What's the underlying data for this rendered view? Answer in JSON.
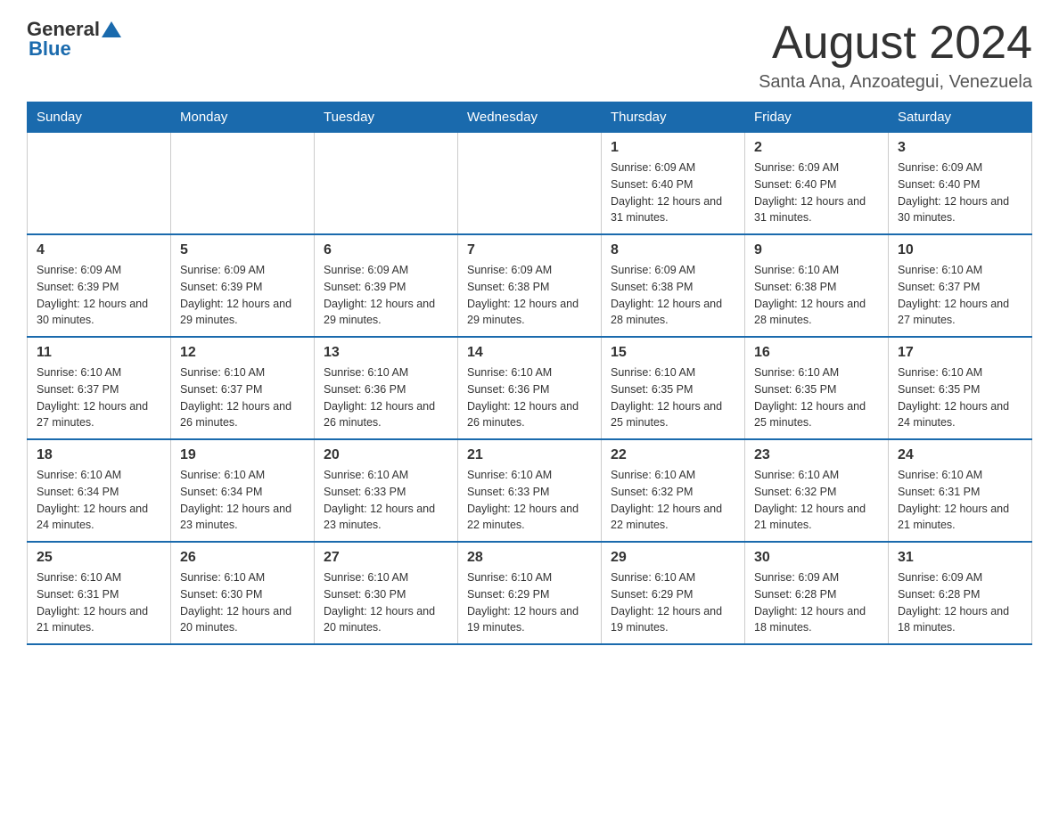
{
  "logo": {
    "text_general": "General",
    "text_blue": "Blue"
  },
  "header": {
    "month_title": "August 2024",
    "location": "Santa Ana, Anzoategui, Venezuela"
  },
  "weekdays": [
    "Sunday",
    "Monday",
    "Tuesday",
    "Wednesday",
    "Thursday",
    "Friday",
    "Saturday"
  ],
  "weeks": [
    {
      "days": [
        {
          "number": "",
          "info": ""
        },
        {
          "number": "",
          "info": ""
        },
        {
          "number": "",
          "info": ""
        },
        {
          "number": "",
          "info": ""
        },
        {
          "number": "1",
          "info": "Sunrise: 6:09 AM\nSunset: 6:40 PM\nDaylight: 12 hours and 31 minutes."
        },
        {
          "number": "2",
          "info": "Sunrise: 6:09 AM\nSunset: 6:40 PM\nDaylight: 12 hours and 31 minutes."
        },
        {
          "number": "3",
          "info": "Sunrise: 6:09 AM\nSunset: 6:40 PM\nDaylight: 12 hours and 30 minutes."
        }
      ]
    },
    {
      "days": [
        {
          "number": "4",
          "info": "Sunrise: 6:09 AM\nSunset: 6:39 PM\nDaylight: 12 hours and 30 minutes."
        },
        {
          "number": "5",
          "info": "Sunrise: 6:09 AM\nSunset: 6:39 PM\nDaylight: 12 hours and 29 minutes."
        },
        {
          "number": "6",
          "info": "Sunrise: 6:09 AM\nSunset: 6:39 PM\nDaylight: 12 hours and 29 minutes."
        },
        {
          "number": "7",
          "info": "Sunrise: 6:09 AM\nSunset: 6:38 PM\nDaylight: 12 hours and 29 minutes."
        },
        {
          "number": "8",
          "info": "Sunrise: 6:09 AM\nSunset: 6:38 PM\nDaylight: 12 hours and 28 minutes."
        },
        {
          "number": "9",
          "info": "Sunrise: 6:10 AM\nSunset: 6:38 PM\nDaylight: 12 hours and 28 minutes."
        },
        {
          "number": "10",
          "info": "Sunrise: 6:10 AM\nSunset: 6:37 PM\nDaylight: 12 hours and 27 minutes."
        }
      ]
    },
    {
      "days": [
        {
          "number": "11",
          "info": "Sunrise: 6:10 AM\nSunset: 6:37 PM\nDaylight: 12 hours and 27 minutes."
        },
        {
          "number": "12",
          "info": "Sunrise: 6:10 AM\nSunset: 6:37 PM\nDaylight: 12 hours and 26 minutes."
        },
        {
          "number": "13",
          "info": "Sunrise: 6:10 AM\nSunset: 6:36 PM\nDaylight: 12 hours and 26 minutes."
        },
        {
          "number": "14",
          "info": "Sunrise: 6:10 AM\nSunset: 6:36 PM\nDaylight: 12 hours and 26 minutes."
        },
        {
          "number": "15",
          "info": "Sunrise: 6:10 AM\nSunset: 6:35 PM\nDaylight: 12 hours and 25 minutes."
        },
        {
          "number": "16",
          "info": "Sunrise: 6:10 AM\nSunset: 6:35 PM\nDaylight: 12 hours and 25 minutes."
        },
        {
          "number": "17",
          "info": "Sunrise: 6:10 AM\nSunset: 6:35 PM\nDaylight: 12 hours and 24 minutes."
        }
      ]
    },
    {
      "days": [
        {
          "number": "18",
          "info": "Sunrise: 6:10 AM\nSunset: 6:34 PM\nDaylight: 12 hours and 24 minutes."
        },
        {
          "number": "19",
          "info": "Sunrise: 6:10 AM\nSunset: 6:34 PM\nDaylight: 12 hours and 23 minutes."
        },
        {
          "number": "20",
          "info": "Sunrise: 6:10 AM\nSunset: 6:33 PM\nDaylight: 12 hours and 23 minutes."
        },
        {
          "number": "21",
          "info": "Sunrise: 6:10 AM\nSunset: 6:33 PM\nDaylight: 12 hours and 22 minutes."
        },
        {
          "number": "22",
          "info": "Sunrise: 6:10 AM\nSunset: 6:32 PM\nDaylight: 12 hours and 22 minutes."
        },
        {
          "number": "23",
          "info": "Sunrise: 6:10 AM\nSunset: 6:32 PM\nDaylight: 12 hours and 21 minutes."
        },
        {
          "number": "24",
          "info": "Sunrise: 6:10 AM\nSunset: 6:31 PM\nDaylight: 12 hours and 21 minutes."
        }
      ]
    },
    {
      "days": [
        {
          "number": "25",
          "info": "Sunrise: 6:10 AM\nSunset: 6:31 PM\nDaylight: 12 hours and 21 minutes."
        },
        {
          "number": "26",
          "info": "Sunrise: 6:10 AM\nSunset: 6:30 PM\nDaylight: 12 hours and 20 minutes."
        },
        {
          "number": "27",
          "info": "Sunrise: 6:10 AM\nSunset: 6:30 PM\nDaylight: 12 hours and 20 minutes."
        },
        {
          "number": "28",
          "info": "Sunrise: 6:10 AM\nSunset: 6:29 PM\nDaylight: 12 hours and 19 minutes."
        },
        {
          "number": "29",
          "info": "Sunrise: 6:10 AM\nSunset: 6:29 PM\nDaylight: 12 hours and 19 minutes."
        },
        {
          "number": "30",
          "info": "Sunrise: 6:09 AM\nSunset: 6:28 PM\nDaylight: 12 hours and 18 minutes."
        },
        {
          "number": "31",
          "info": "Sunrise: 6:09 AM\nSunset: 6:28 PM\nDaylight: 12 hours and 18 minutes."
        }
      ]
    }
  ]
}
